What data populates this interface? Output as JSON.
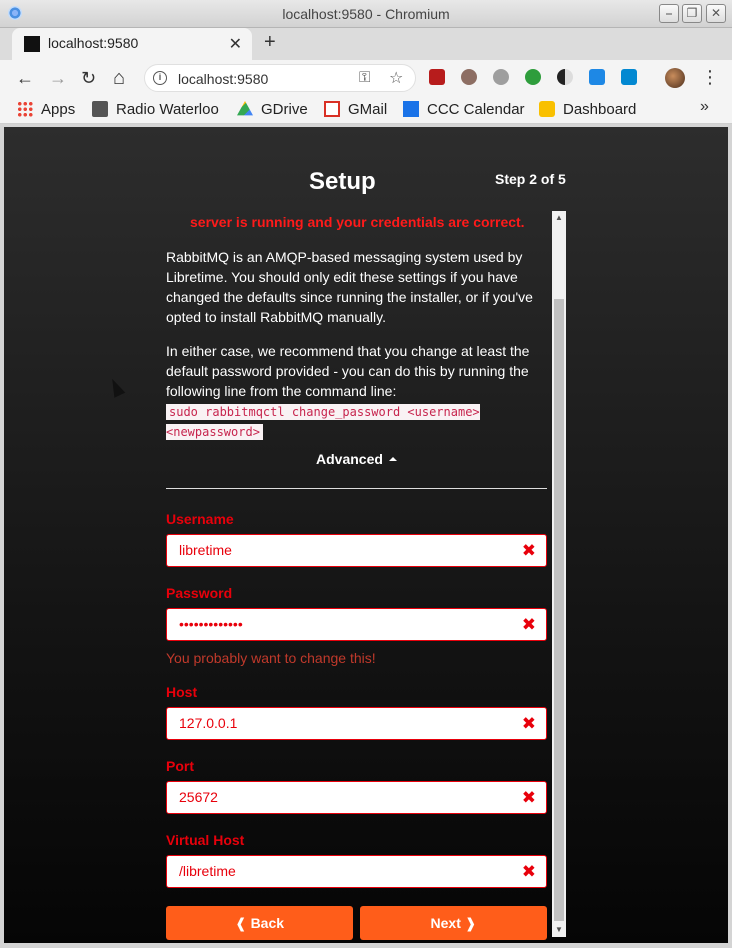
{
  "window": {
    "title": "localhost:9580 - Chromium",
    "controls": {
      "minimize": "⎯",
      "maximize": "❐",
      "close": "✕"
    }
  },
  "tab": {
    "title": "localhost:9580",
    "close": "✕",
    "new_tab": "+"
  },
  "toolbar": {
    "back": "←",
    "forward": "→",
    "reload": "↻",
    "home": "⌂",
    "url": "localhost:9580",
    "key_icon": "⚿",
    "star_icon": "☆",
    "menu": "⋮"
  },
  "bookmarks": {
    "items": [
      {
        "label": "Apps",
        "icon": "apps-grid-icon"
      },
      {
        "label": "Radio Waterloo",
        "icon": "folder-icon"
      },
      {
        "label": "GDrive",
        "icon": "drive-icon"
      },
      {
        "label": "GMail",
        "icon": "gmail-icon"
      },
      {
        "label": "CCC Calendar",
        "icon": "calendar-icon"
      },
      {
        "label": "Dashboard",
        "icon": "dashboard-icon"
      }
    ],
    "more": "»"
  },
  "page": {
    "title": "Setup",
    "step": "Step 2 of 5",
    "status_message": "server is running and your credentials are correct.",
    "intro": "RabbitMQ is an AMQP-based messaging system used by Libretime. You should only edit these settings if you have changed the defaults since running the installer, or if you've opted to install RabbitMQ manually.",
    "recommend": "In either case, we recommend that you change at least the default password provided - you can do this by running the following line from the command line:",
    "command": "sudo rabbitmqctl change_password <username> <newpassword>",
    "advanced_label": "Advanced",
    "fields": {
      "username": {
        "label": "Username",
        "value": "libretime"
      },
      "password": {
        "label": "Password",
        "value": "•••••••••••••",
        "hint": "You probably want to change this!"
      },
      "host": {
        "label": "Host",
        "value": "127.0.0.1"
      },
      "port": {
        "label": "Port",
        "value": "25672"
      },
      "vhost": {
        "label": "Virtual Host",
        "value": "/libretime"
      }
    },
    "clear_glyph": "✖",
    "back_button": "❰ Back",
    "next_button": "Next ❱"
  },
  "colors": {
    "accent": "#ff5d1a",
    "error": "#e8000b"
  }
}
